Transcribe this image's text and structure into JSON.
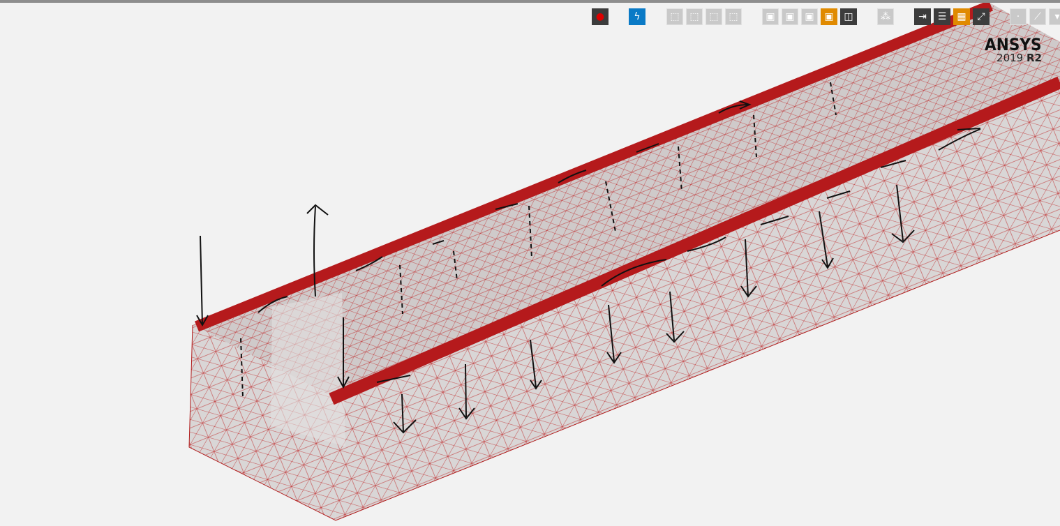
{
  "toolbar": [
    {
      "icon": "record-icon",
      "style": "dark",
      "glyph": "●"
    },
    {
      "icon": "solve-lightning-icon",
      "style": "blue",
      "glyph": "ϟ"
    },
    {
      "icon": "select-mode-icon",
      "style": "gray",
      "glyph": "⬚"
    },
    {
      "icon": "select-face-icon",
      "style": "gray",
      "glyph": "⬚"
    },
    {
      "icon": "select-edge-icon",
      "style": "gray",
      "glyph": "⬚"
    },
    {
      "icon": "select-body-icon",
      "style": "gray",
      "glyph": "⬚"
    },
    {
      "icon": "view-box-1-icon",
      "style": "gray",
      "glyph": "▣"
    },
    {
      "icon": "view-box-2-icon",
      "style": "gray",
      "glyph": "▣"
    },
    {
      "icon": "view-box-3-icon",
      "style": "gray",
      "glyph": "▣"
    },
    {
      "icon": "view-box-active-icon",
      "style": "orange",
      "glyph": "▣"
    },
    {
      "icon": "view-cube-dropdown-icon",
      "style": "dark",
      "glyph": "◫"
    },
    {
      "icon": "explode-icon",
      "style": "gray",
      "glyph": "⁂"
    },
    {
      "icon": "import-icon",
      "style": "dark",
      "glyph": "⇥"
    },
    {
      "icon": "tree-icon",
      "style": "dark",
      "glyph": "☰"
    },
    {
      "icon": "ruler-icon",
      "style": "orange",
      "glyph": "▦"
    },
    {
      "icon": "fullscreen-icon",
      "style": "dark",
      "glyph": "⤢"
    },
    {
      "icon": "extra-1-icon",
      "style": "gray",
      "glyph": "·"
    },
    {
      "icon": "extra-2-icon",
      "style": "gray",
      "glyph": "⟋"
    },
    {
      "icon": "extra-3-icon",
      "style": "gray",
      "glyph": "▾"
    }
  ],
  "logo": {
    "brand": "ANSYS",
    "version": "2019",
    "release": "R2"
  },
  "colors": {
    "mesh": "#b01a1a",
    "body": "#d6d6d6",
    "background": "#f2f2f2"
  }
}
